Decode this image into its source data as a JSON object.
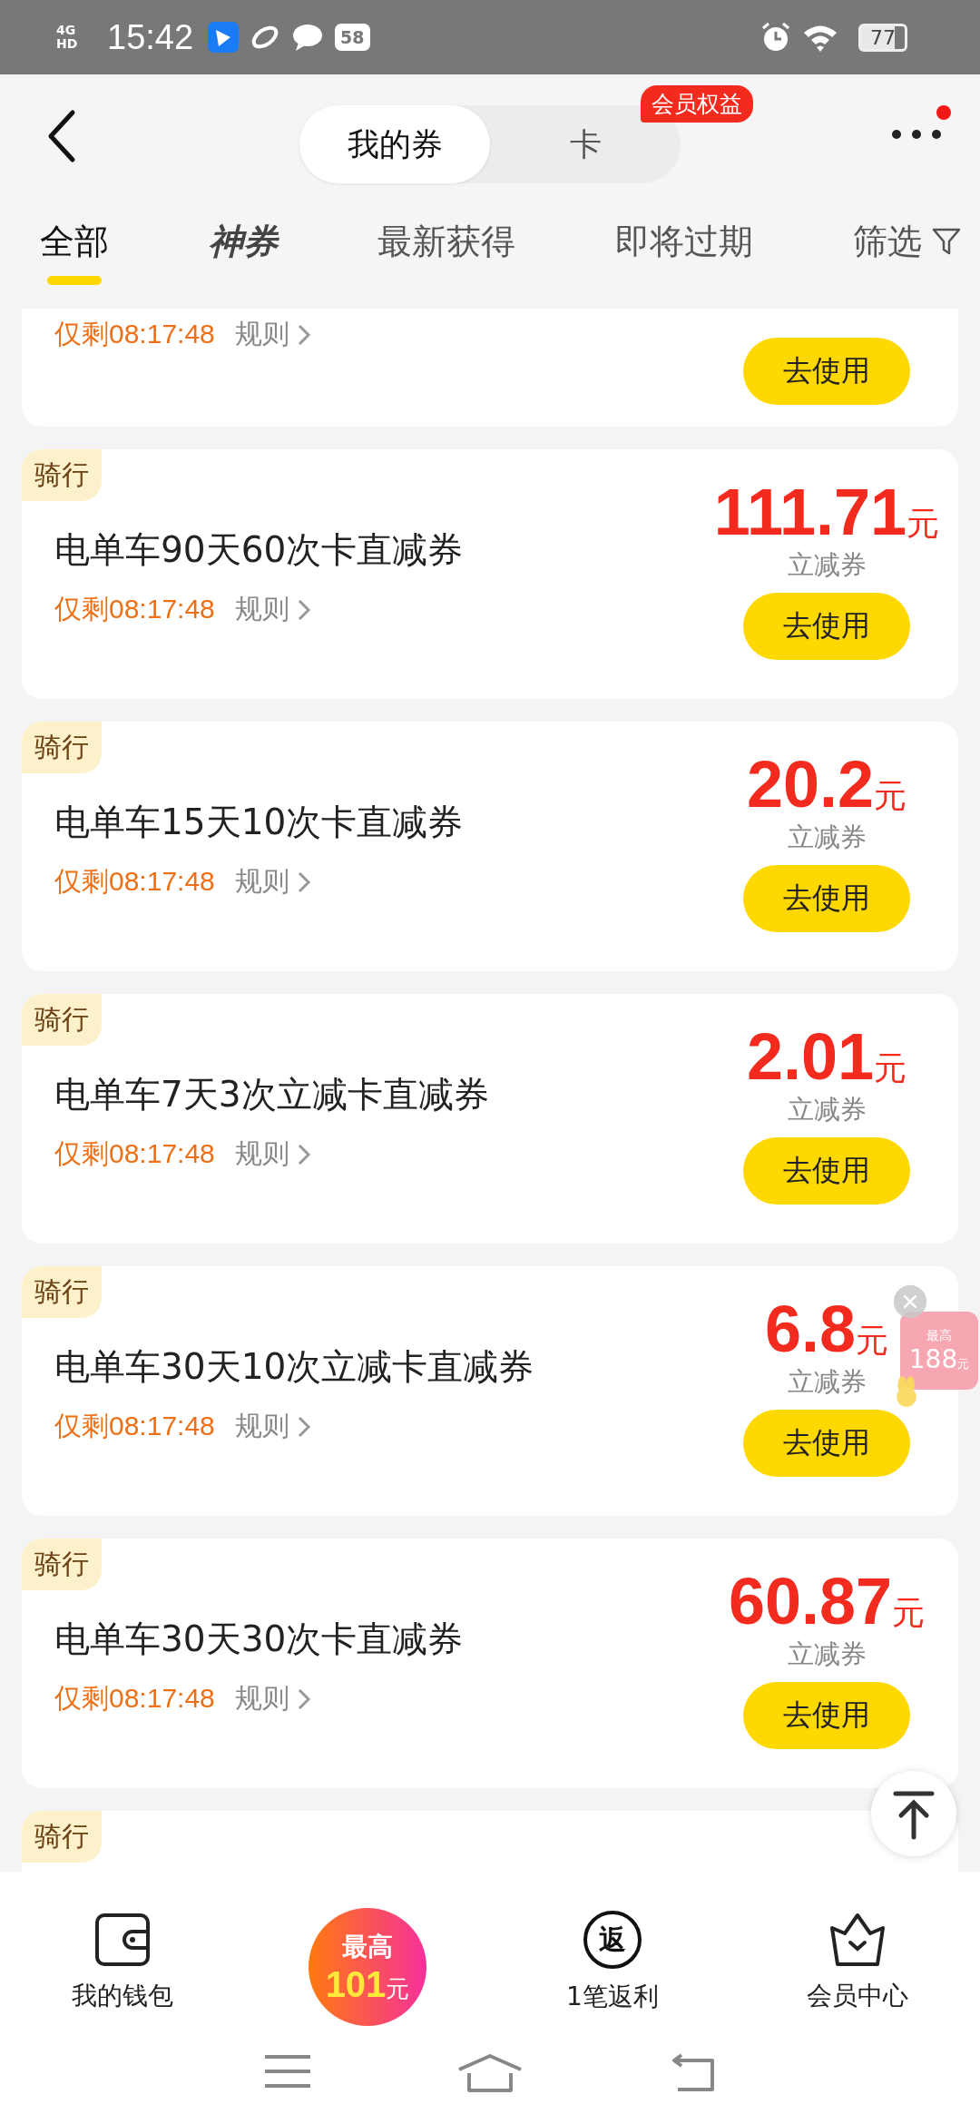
{
  "status_bar": {
    "network": "4G HD",
    "time": "15:42",
    "notification_count": "58",
    "battery": "77"
  },
  "header": {
    "segments": [
      {
        "label": "我的券",
        "selected": true
      },
      {
        "label": "卡",
        "selected": false
      }
    ],
    "badge": "会员权益",
    "has_dot": true
  },
  "tabs": [
    {
      "label": "全部",
      "selected": true,
      "kind": "plain"
    },
    {
      "label": "神券",
      "selected": false,
      "kind": "special"
    },
    {
      "label": "最新获得",
      "selected": false,
      "kind": "plain"
    },
    {
      "label": "即将过期",
      "selected": false,
      "kind": "plain"
    },
    {
      "label": "筛选",
      "selected": false,
      "kind": "filter"
    }
  ],
  "coupons": [
    {
      "kind": "partial",
      "timer": "仅剩08:17:48",
      "rules": "规则",
      "button": "去使用"
    },
    {
      "kind": "full",
      "tag": "骑行",
      "title": "电单车90天60次卡直减券",
      "timer": "仅剩08:17:48",
      "rules": "规则",
      "amount": "111.71",
      "unit": "元",
      "label": "立减券",
      "button": "去使用"
    },
    {
      "kind": "full",
      "tag": "骑行",
      "title": "电单车15天10次卡直减券",
      "timer": "仅剩08:17:48",
      "rules": "规则",
      "amount": "20.2",
      "unit": "元",
      "label": "立减券",
      "button": "去使用"
    },
    {
      "kind": "full",
      "tag": "骑行",
      "title": "电单车7天3次立减卡直减券",
      "timer": "仅剩08:17:48",
      "rules": "规则",
      "amount": "2.01",
      "unit": "元",
      "label": "立减券",
      "button": "去使用"
    },
    {
      "kind": "full",
      "tag": "骑行",
      "title": "电单车30天10次立减卡直减券",
      "timer": "仅剩08:17:48",
      "rules": "规则",
      "amount": "6.8",
      "unit": "元",
      "label": "立减券",
      "button": "去使用"
    },
    {
      "kind": "full",
      "tag": "骑行",
      "title": "电单车30天30次卡直减券",
      "timer": "仅剩08:17:48",
      "rules": "规则",
      "amount": "60.87",
      "unit": "元",
      "label": "立减券",
      "button": "去使用"
    },
    {
      "kind": "cut",
      "tag": "骑行"
    }
  ],
  "floating_promo": {
    "caption": "最高",
    "amount": "188",
    "unit": "元"
  },
  "bottom_nav": [
    {
      "kind": "wallet",
      "label": "我的钱包"
    },
    {
      "kind": "promo",
      "caption": "最高",
      "amount": "101",
      "unit": "元"
    },
    {
      "kind": "rebate",
      "icon_text": "返",
      "label": "1笔返利"
    },
    {
      "kind": "member",
      "label": "会员中心"
    }
  ]
}
